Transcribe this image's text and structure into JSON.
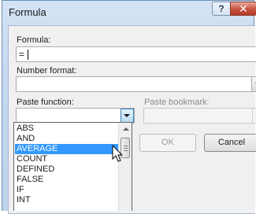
{
  "window": {
    "title": "Formula",
    "help_label": "?",
    "close_label": "✕"
  },
  "formula": {
    "label": "Formula:",
    "value": "="
  },
  "number_format": {
    "label": "Number format:",
    "value": ""
  },
  "paste_function": {
    "label": "Paste function:",
    "value": "",
    "options": [
      "ABS",
      "AND",
      "AVERAGE",
      "COUNT",
      "DEFINED",
      "FALSE",
      "IF",
      "INT"
    ],
    "selected": "AVERAGE"
  },
  "paste_bookmark": {
    "label": "Paste bookmark:",
    "value": ""
  },
  "buttons": {
    "ok": "OK",
    "cancel": "Cancel"
  },
  "icons": {
    "help": "question-mark-icon",
    "close": "close-icon",
    "dropdown": "chevron-down-icon",
    "pointer": "mouse-pointer-icon"
  }
}
